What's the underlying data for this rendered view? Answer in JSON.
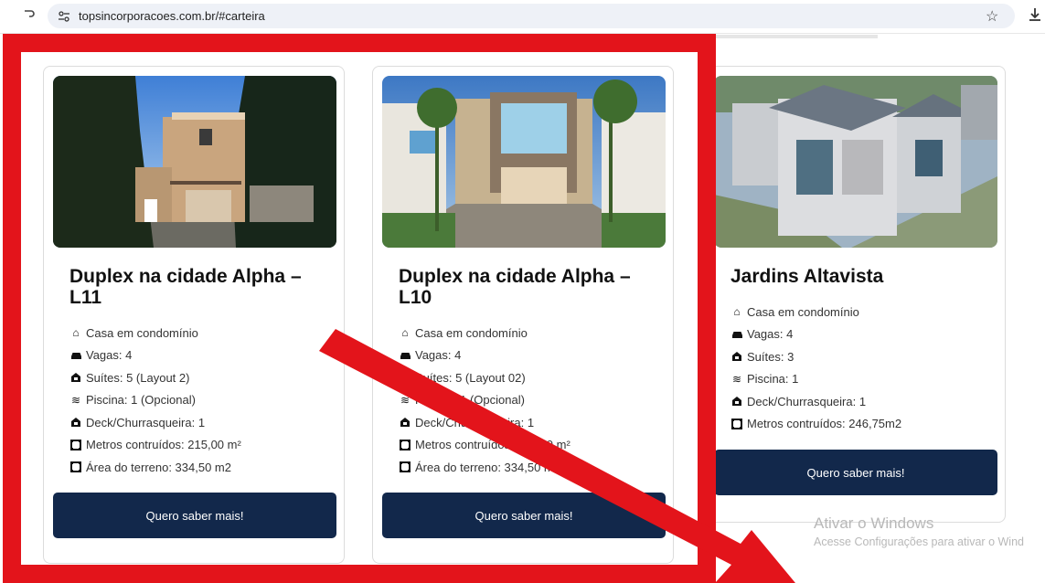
{
  "browser": {
    "url": "topsincorporacoes.com.br/#carteira"
  },
  "cards": [
    {
      "title": "Duplex na cidade Alpha – L11",
      "features": [
        {
          "icon": "home-icon",
          "text": "Casa em condomínio"
        },
        {
          "icon": "car-icon",
          "text": "Vagas: 4"
        },
        {
          "icon": "bed-icon",
          "text": "Suítes: 5 (Layout 2)"
        },
        {
          "icon": "water-icon",
          "text": "Piscina: 1 (Opcional)"
        },
        {
          "icon": "grill-icon",
          "text": "Deck/Churrasqueira: 1"
        },
        {
          "icon": "area-icon",
          "text": "Metros contruídos: 215,00 m²"
        },
        {
          "icon": "area-icon",
          "text": "Área do terreno: 334,50 m2"
        }
      ],
      "button": "Quero saber mais!"
    },
    {
      "title": "Duplex na cidade Alpha – L10",
      "features": [
        {
          "icon": "home-icon",
          "text": "Casa em condomínio"
        },
        {
          "icon": "car-icon",
          "text": "Vagas: 4"
        },
        {
          "icon": "bed-icon",
          "text": "Suítes: 5 (Layout 02)"
        },
        {
          "icon": "water-icon",
          "text": "Piscina: 1 (Opcional)"
        },
        {
          "icon": "grill-icon",
          "text": "Deck/Churrasqueira: 1"
        },
        {
          "icon": "area-icon",
          "text": "Metros contruídos: 215,00 m²"
        },
        {
          "icon": "area-icon",
          "text": "Área do terreno: 334,50 m2"
        }
      ],
      "button": "Quero saber mais!"
    },
    {
      "title": "Jardins Altavista",
      "features": [
        {
          "icon": "home-icon",
          "text": "Casa em condomínio"
        },
        {
          "icon": "car-icon",
          "text": "Vagas: 4"
        },
        {
          "icon": "bed-icon",
          "text": "Suítes: 3"
        },
        {
          "icon": "water-icon",
          "text": "Piscina: 1"
        },
        {
          "icon": "grill-icon",
          "text": "Deck/Churrasqueira: 1"
        },
        {
          "icon": "area-icon",
          "text": "Metros contruídos: 246,75m2"
        }
      ],
      "button": "Quero saber mais!"
    }
  ],
  "watermark": {
    "line1": "Ativar o Windows",
    "line2": "Acesse Configurações para ativar o Wind"
  },
  "colors": {
    "button": "#12284b",
    "annotation": "#e3141b"
  }
}
